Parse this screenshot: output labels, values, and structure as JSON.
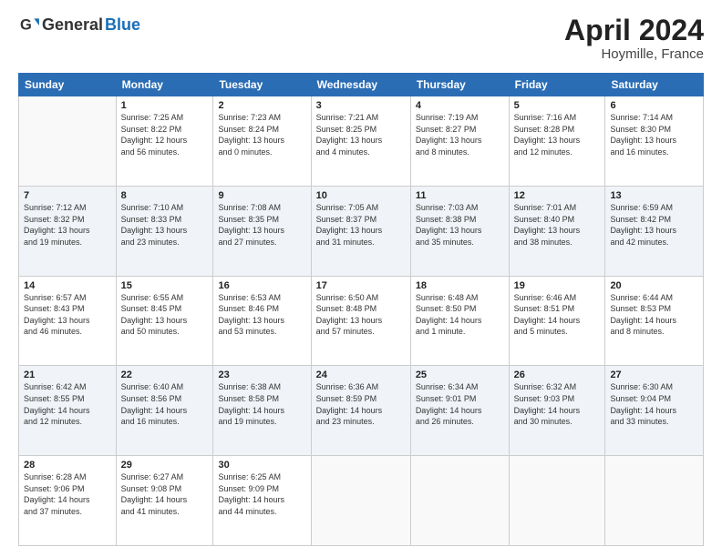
{
  "header": {
    "logo_general": "General",
    "logo_blue": "Blue",
    "month_title": "April 2024",
    "location": "Hoymille, France"
  },
  "weekdays": [
    "Sunday",
    "Monday",
    "Tuesday",
    "Wednesday",
    "Thursday",
    "Friday",
    "Saturday"
  ],
  "weeks": [
    [
      {
        "day": "",
        "info": ""
      },
      {
        "day": "1",
        "info": "Sunrise: 7:25 AM\nSunset: 8:22 PM\nDaylight: 12 hours\nand 56 minutes."
      },
      {
        "day": "2",
        "info": "Sunrise: 7:23 AM\nSunset: 8:24 PM\nDaylight: 13 hours\nand 0 minutes."
      },
      {
        "day": "3",
        "info": "Sunrise: 7:21 AM\nSunset: 8:25 PM\nDaylight: 13 hours\nand 4 minutes."
      },
      {
        "day": "4",
        "info": "Sunrise: 7:19 AM\nSunset: 8:27 PM\nDaylight: 13 hours\nand 8 minutes."
      },
      {
        "day": "5",
        "info": "Sunrise: 7:16 AM\nSunset: 8:28 PM\nDaylight: 13 hours\nand 12 minutes."
      },
      {
        "day": "6",
        "info": "Sunrise: 7:14 AM\nSunset: 8:30 PM\nDaylight: 13 hours\nand 16 minutes."
      }
    ],
    [
      {
        "day": "7",
        "info": "Sunrise: 7:12 AM\nSunset: 8:32 PM\nDaylight: 13 hours\nand 19 minutes."
      },
      {
        "day": "8",
        "info": "Sunrise: 7:10 AM\nSunset: 8:33 PM\nDaylight: 13 hours\nand 23 minutes."
      },
      {
        "day": "9",
        "info": "Sunrise: 7:08 AM\nSunset: 8:35 PM\nDaylight: 13 hours\nand 27 minutes."
      },
      {
        "day": "10",
        "info": "Sunrise: 7:05 AM\nSunset: 8:37 PM\nDaylight: 13 hours\nand 31 minutes."
      },
      {
        "day": "11",
        "info": "Sunrise: 7:03 AM\nSunset: 8:38 PM\nDaylight: 13 hours\nand 35 minutes."
      },
      {
        "day": "12",
        "info": "Sunrise: 7:01 AM\nSunset: 8:40 PM\nDaylight: 13 hours\nand 38 minutes."
      },
      {
        "day": "13",
        "info": "Sunrise: 6:59 AM\nSunset: 8:42 PM\nDaylight: 13 hours\nand 42 minutes."
      }
    ],
    [
      {
        "day": "14",
        "info": "Sunrise: 6:57 AM\nSunset: 8:43 PM\nDaylight: 13 hours\nand 46 minutes."
      },
      {
        "day": "15",
        "info": "Sunrise: 6:55 AM\nSunset: 8:45 PM\nDaylight: 13 hours\nand 50 minutes."
      },
      {
        "day": "16",
        "info": "Sunrise: 6:53 AM\nSunset: 8:46 PM\nDaylight: 13 hours\nand 53 minutes."
      },
      {
        "day": "17",
        "info": "Sunrise: 6:50 AM\nSunset: 8:48 PM\nDaylight: 13 hours\nand 57 minutes."
      },
      {
        "day": "18",
        "info": "Sunrise: 6:48 AM\nSunset: 8:50 PM\nDaylight: 14 hours\nand 1 minute."
      },
      {
        "day": "19",
        "info": "Sunrise: 6:46 AM\nSunset: 8:51 PM\nDaylight: 14 hours\nand 5 minutes."
      },
      {
        "day": "20",
        "info": "Sunrise: 6:44 AM\nSunset: 8:53 PM\nDaylight: 14 hours\nand 8 minutes."
      }
    ],
    [
      {
        "day": "21",
        "info": "Sunrise: 6:42 AM\nSunset: 8:55 PM\nDaylight: 14 hours\nand 12 minutes."
      },
      {
        "day": "22",
        "info": "Sunrise: 6:40 AM\nSunset: 8:56 PM\nDaylight: 14 hours\nand 16 minutes."
      },
      {
        "day": "23",
        "info": "Sunrise: 6:38 AM\nSunset: 8:58 PM\nDaylight: 14 hours\nand 19 minutes."
      },
      {
        "day": "24",
        "info": "Sunrise: 6:36 AM\nSunset: 8:59 PM\nDaylight: 14 hours\nand 23 minutes."
      },
      {
        "day": "25",
        "info": "Sunrise: 6:34 AM\nSunset: 9:01 PM\nDaylight: 14 hours\nand 26 minutes."
      },
      {
        "day": "26",
        "info": "Sunrise: 6:32 AM\nSunset: 9:03 PM\nDaylight: 14 hours\nand 30 minutes."
      },
      {
        "day": "27",
        "info": "Sunrise: 6:30 AM\nSunset: 9:04 PM\nDaylight: 14 hours\nand 33 minutes."
      }
    ],
    [
      {
        "day": "28",
        "info": "Sunrise: 6:28 AM\nSunset: 9:06 PM\nDaylight: 14 hours\nand 37 minutes."
      },
      {
        "day": "29",
        "info": "Sunrise: 6:27 AM\nSunset: 9:08 PM\nDaylight: 14 hours\nand 41 minutes."
      },
      {
        "day": "30",
        "info": "Sunrise: 6:25 AM\nSunset: 9:09 PM\nDaylight: 14 hours\nand 44 minutes."
      },
      {
        "day": "",
        "info": ""
      },
      {
        "day": "",
        "info": ""
      },
      {
        "day": "",
        "info": ""
      },
      {
        "day": "",
        "info": ""
      }
    ]
  ]
}
